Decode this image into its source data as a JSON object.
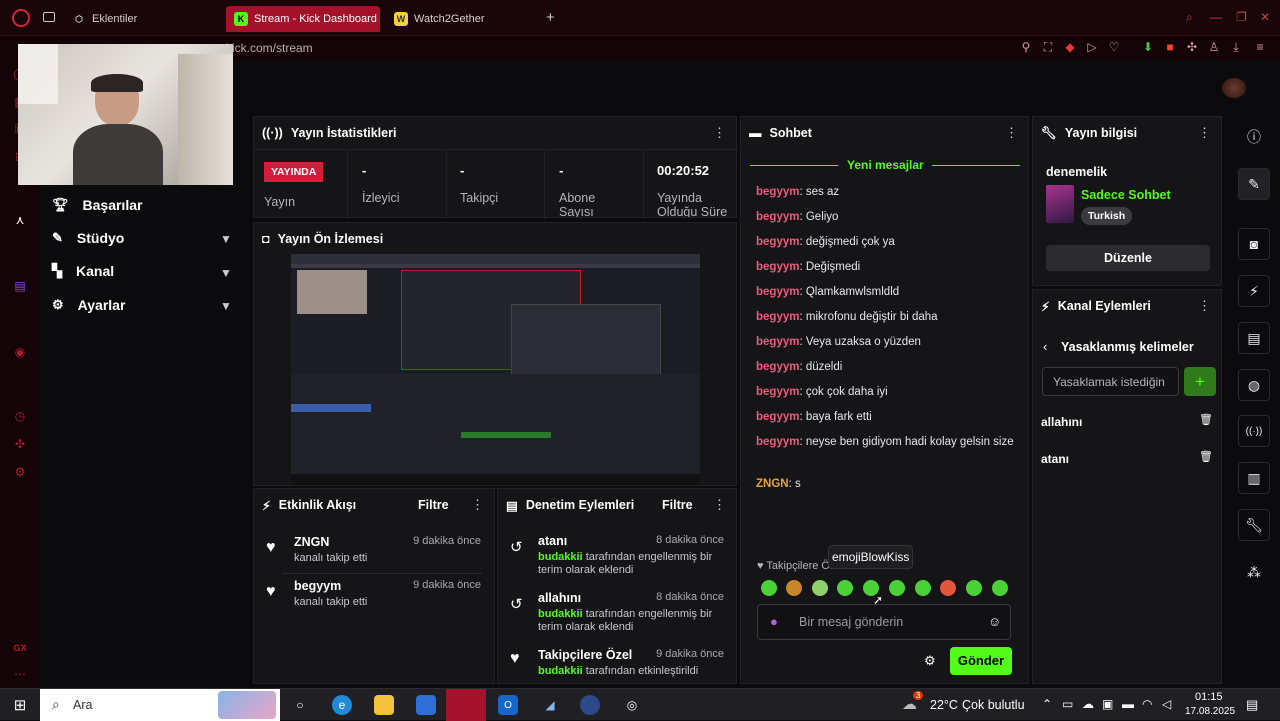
{
  "browser": {
    "tabs": [
      {
        "label": "Eklentiler",
        "icon": "cube-icon"
      },
      {
        "label": "Stream - Kick Dashboard",
        "icon": "kick-icon",
        "active": true
      },
      {
        "label": "Watch2Gether",
        "icon": "w2g-icon"
      }
    ],
    "url": "kick.com/stream"
  },
  "sidebar": {
    "items": [
      {
        "label": "Başarılar",
        "icon": "trophy-icon",
        "expandable": false
      },
      {
        "label": "Stüdyo",
        "icon": "studio-icon",
        "expandable": true
      },
      {
        "label": "Kanal",
        "icon": "channel-icon",
        "expandable": true
      },
      {
        "label": "Ayarlar",
        "icon": "gear-icon",
        "expandable": true
      }
    ]
  },
  "stats": {
    "title": "Yayın İstatistikleri",
    "live_badge": "YAYINDA",
    "live_label": "Yayın",
    "viewers_value": "-",
    "viewers_label": "İzleyici",
    "followers_value": "-",
    "followers_label": "Takipçi",
    "subs_value": "-",
    "subs_label": "Abone Sayısı",
    "uptime_value": "00:20:52",
    "uptime_label": "Yayında Olduğu Süre"
  },
  "preview": {
    "title": "Yayın Ön İzlemesi"
  },
  "activity": {
    "title": "Etkinlik Akışı",
    "filter": "Filtre",
    "items": [
      {
        "name": "ZNGN",
        "desc": "kanalı takip etti",
        "time": "9 dakika önce"
      },
      {
        "name": "begyym",
        "desc": "kanalı takip etti",
        "time": "9 dakika önce"
      }
    ]
  },
  "moderation": {
    "title": "Denetim Eylemleri",
    "filter": "Filtre",
    "items": [
      {
        "title": "atanı",
        "time": "8 dakika önce",
        "user": "budakkii",
        "desc": "tarafından engellenmiş bir terim olarak eklendi"
      },
      {
        "title": "allahını",
        "time": "8 dakika önce",
        "user": "budakkii",
        "desc": "tarafından engellenmiş bir terim olarak eklendi"
      },
      {
        "title": "Takipçilere Özel",
        "time": "9 dakika önce",
        "user": "budakkii",
        "desc": "tarafından etkinleştirildi"
      }
    ]
  },
  "chat": {
    "title": "Sohbet",
    "new_messages": "Yeni mesajlar",
    "messages": [
      {
        "user": "begyym",
        "text": ": ses az"
      },
      {
        "user": "begyym",
        "text": ": Geliyo"
      },
      {
        "user": "begyym",
        "text": ": değişmedi çok ya"
      },
      {
        "user": "begyym",
        "text": ": Değişmedi"
      },
      {
        "user": "begyym",
        "text": ": Qlamkamwlsmldld"
      },
      {
        "user": "begyym",
        "text": ": mikrofonu değiştir bi daha"
      },
      {
        "user": "begyym",
        "text": ": Veya uzaksa o yüzden"
      },
      {
        "user": "begyym",
        "text": ": düzeldi"
      },
      {
        "user": "begyym",
        "text": ": çok çok daha iyi"
      },
      {
        "user": "begyym",
        "text": ": baya fark etti"
      },
      {
        "user": "begyym",
        "text": ": neyse ben gidiyom hadi kolay gelsin size"
      },
      {
        "user": "ZNGN",
        "text": ": s",
        "user_color": "#e8a33a"
      }
    ],
    "followers_only": "Takipçilere Özel",
    "tooltip": "emojiBlowKiss",
    "input_placeholder": "Bir mesaj gönderin",
    "send": "Gönder"
  },
  "stream_info": {
    "title": "Yayın bilgisi",
    "stream_title": "denemelik",
    "category": "Sadece Sohbet",
    "tag": "Turkish",
    "edit": "Düzenle"
  },
  "channel_actions": {
    "title": "Kanal Eylemleri",
    "banned_title": "Yasaklanmış kelimeler",
    "input_placeholder": "Yasaklamak istediğin",
    "words": [
      "allahını",
      "atanı"
    ]
  },
  "taskbar": {
    "search": "Ara",
    "weather_temp": "22°C",
    "weather_desc": "Çok bulutlu",
    "weather_badge": "3",
    "time": "01:15",
    "date": "17.08.2025"
  },
  "colors": {
    "kick_green": "#53fc18",
    "live_red": "#d41c3c",
    "opera_red": "#a3122a"
  }
}
